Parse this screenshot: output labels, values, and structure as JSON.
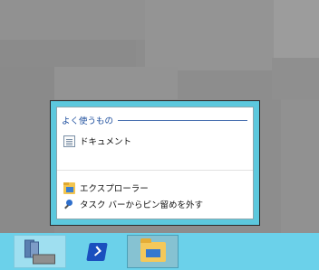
{
  "jumplist": {
    "section_title": "よく使うもの",
    "frequent_items": [
      {
        "label": "ドキュメント",
        "icon": "document-icon"
      }
    ],
    "tasks": [
      {
        "label": "エクスプローラー",
        "icon": "folder-icon"
      },
      {
        "label": "タスク バーからピン留めを外す",
        "icon": "unpin-icon"
      }
    ]
  },
  "taskbar": {
    "buttons": [
      {
        "icon": "server-manager-icon"
      },
      {
        "icon": "powershell-icon"
      },
      {
        "icon": "file-explorer-icon"
      }
    ]
  },
  "colors": {
    "taskbar": "#6bd1ea",
    "jumplist_frame": "#5cc8dd",
    "section_title": "#1e4f9e"
  }
}
